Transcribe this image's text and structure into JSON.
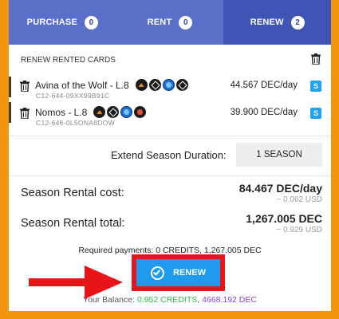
{
  "tabs": [
    {
      "label": "PURCHASE",
      "count": "0"
    },
    {
      "label": "RENT",
      "count": "0"
    },
    {
      "label": "RENEW",
      "count": "2"
    }
  ],
  "section": {
    "title": "RENEW RENTED CARDS"
  },
  "cards": [
    {
      "name": "Avina of the Wolf - L.8",
      "id": "C12-644-09XX99B91C",
      "price": "44.567 DEC/day",
      "badge": "S",
      "icons": [
        "orange-mark-icon",
        "diamond-icon",
        "water-icon",
        "star-icon"
      ]
    },
    {
      "name": "Nomos - L.8",
      "id": "C12-646-0L5ONA8DOW",
      "price": "39.900 DEC/day",
      "badge": "S",
      "icons": [
        "orange-mark-icon",
        "diamond-icon",
        "water-icon",
        "fire-icon"
      ]
    }
  ],
  "extend": {
    "label": "Extend Season Duration:",
    "value": "1 SEASON"
  },
  "summary": {
    "cost_label": "Season Rental cost:",
    "cost_value": "84.467 DEC/day",
    "cost_usd": "~ 0.062 USD",
    "total_label": "Season Rental total:",
    "total_value": "1,267.005 DEC",
    "total_usd": "~ 0.929 USD"
  },
  "required": "Required payments: 0 CREDITS, 1,267.005 DEC",
  "renew_button": "RENEW",
  "balance": {
    "prefix": "Your Balance: ",
    "credits": "0.952 CREDITS",
    "separator": ", ",
    "dec": "4668.192 DEC"
  },
  "colors": {
    "background": "#f5950d",
    "tab_bar": "#5a6fc8",
    "tab_active": "#3f55b5",
    "button": "#1e9bef",
    "highlight": "#e8141a",
    "credits": "#33b84a",
    "dec": "#8b3fd9"
  }
}
